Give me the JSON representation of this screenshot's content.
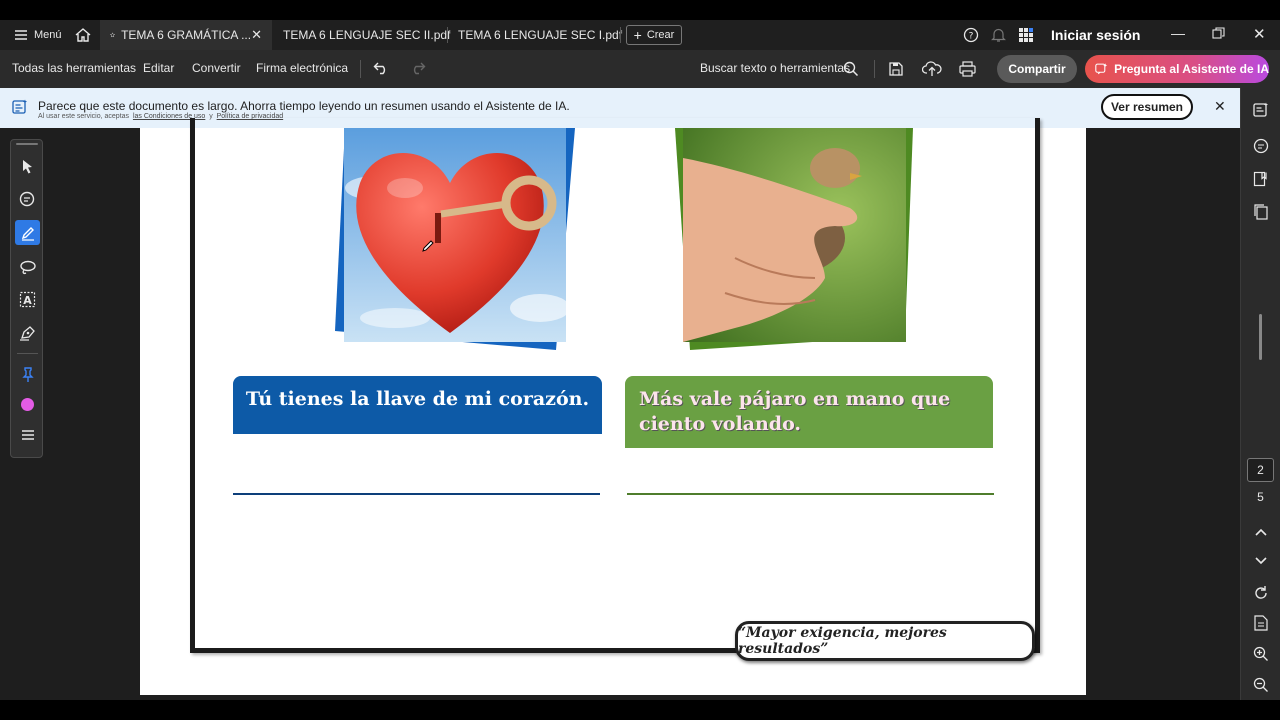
{
  "tabbar": {
    "menu_label": "Menú",
    "tabs": [
      {
        "label": "TEMA 6 GRAMÁTICA ...",
        "active": true
      },
      {
        "label": "TEMA 6 LENGUAJE SEC II.pdf",
        "active": false
      },
      {
        "label": "TEMA 6 LENGUAJE SEC I.pdf",
        "active": false
      }
    ],
    "create_label": "Crear",
    "signin_label": "Iniciar sesión"
  },
  "toolbar": {
    "all_tools": "Todas las herramientas",
    "edit": "Editar",
    "convert": "Convertir",
    "esign": "Firma electrónica",
    "search_placeholder": "Buscar texto o herramientas",
    "share_label": "Compartir",
    "ai_label": "Pregunta al Asistente de IA"
  },
  "banner": {
    "message": "Parece que este documento es largo. Ahorra tiempo leyendo un resumen usando el Asistente de IA.",
    "legal_prefix": "Al usar este servicio, aceptas",
    "terms_link": "las Condiciones de uso",
    "and": "y",
    "privacy_link": "Política de privacidad",
    "button_label": "Ver resumen"
  },
  "document": {
    "caption_left": "Tú tienes la llave de mi corazón.",
    "caption_right": "Más vale pájaro en mano que ciento volando.",
    "motto": "“Mayor exigencia, mejores resultados”"
  },
  "page_nav": {
    "current_page": "2",
    "total_pages": "5"
  },
  "colors": {
    "blue_box": "#0d5aa7",
    "green_box": "#6aa043",
    "share_button": "#5a5a5a",
    "ai_button": "#e8534c",
    "ai_button_end": "#b94ae0",
    "highlight_active": "#2f7ae5",
    "pink_color_dot": "#e45ce6"
  }
}
